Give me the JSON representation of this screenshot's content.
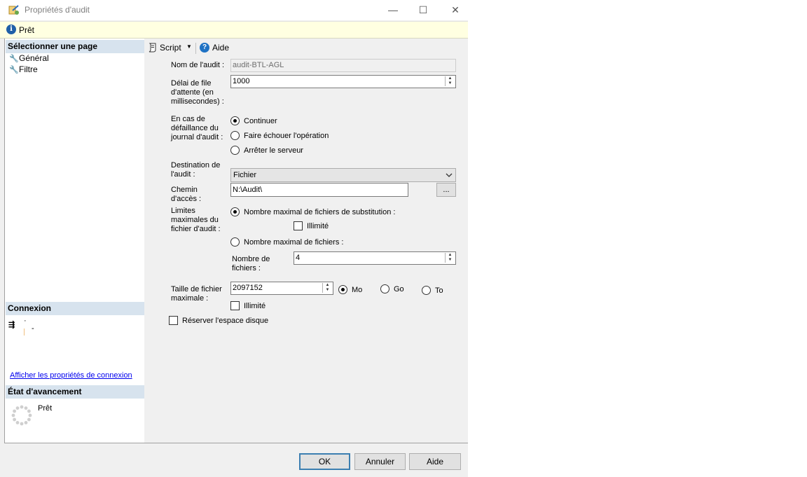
{
  "window": {
    "title": "Propriétés d'audit",
    "minimize": "—",
    "maximize": "☐",
    "close": "✕"
  },
  "status": {
    "icon": "info-icon",
    "text": "Prêt"
  },
  "left_panel": {
    "select_page_header": "Sélectionner une page",
    "pages": [
      {
        "label": "Général",
        "icon": "wrench-icon"
      },
      {
        "label": "Filtre",
        "icon": "wrench-icon"
      }
    ],
    "connection_header": "Connexion",
    "connection_info_a": "·",
    "connection_info_b": "-",
    "connection_link": "Afficher les propriétés de connexion",
    "progress_header": "État d'avancement",
    "progress_text": "Prêt"
  },
  "toolbar": {
    "script_label": "Script",
    "help_label": "Aide"
  },
  "form": {
    "audit_name_label": "Nom de l'audit :",
    "audit_name_value": "audit-BTL-AGL",
    "queue_delay_label_1": "Délai de file",
    "queue_delay_label_2": "d'attente (en",
    "queue_delay_label_3": "millisecondes) :",
    "queue_delay_value": "1000",
    "failure_label_1": "En cas de",
    "failure_label_2": "défaillance du",
    "failure_label_3": "journal d'audit :",
    "failure_options": [
      "Continuer",
      "Faire échouer l'opération",
      "Arrêter le serveur"
    ],
    "failure_selected": 0,
    "destination_label_1": "Destination de",
    "destination_label_2": "l'audit :",
    "destination_value": "Fichier",
    "path_label_1": "Chemin",
    "path_label_2": "d'accès :",
    "path_value": "N:\\Audit\\",
    "browse_label": "...",
    "limits_label_1": "Limites",
    "limits_label_2": "maximales du",
    "limits_label_3": "fichier d'audit :",
    "max_rollover_label": "Nombre maximal de fichiers de substitution :",
    "unlimited_label": "Illimité",
    "max_files_label": "Nombre maximal de fichiers :",
    "files_count_label_1": "Nombre de",
    "files_count_label_2": "fichiers :",
    "files_count_value": "4",
    "max_size_label_1": "Taille de fichier",
    "max_size_label_2": "maximale :",
    "max_size_value": "2097152",
    "size_units": [
      "Mo",
      "Go",
      "To"
    ],
    "size_unit_selected": 0,
    "size_unlimited_label": "Illimité",
    "reserve_disk_label": "Réserver l'espace disque"
  },
  "buttons": {
    "ok": "OK",
    "cancel": "Annuler",
    "help": "Aide"
  }
}
